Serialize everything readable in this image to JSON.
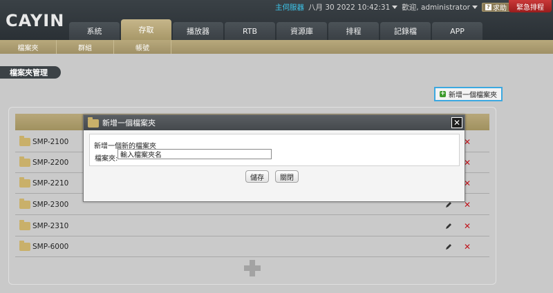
{
  "header": {
    "logo": "CAYIN",
    "server": "主伺服器",
    "datetime": "八月 30 2022 10:42:31",
    "welcome": "歡迎, administrator",
    "help": "求助",
    "emergency": "緊急排程"
  },
  "tabs": [
    "系統",
    "存取",
    "播放器",
    "RTB",
    "資源庫",
    "排程",
    "記錄檔",
    "APP"
  ],
  "active_tab": "存取",
  "subtabs": [
    "檔案夾",
    "群組",
    "帳號"
  ],
  "page_title": "檔案夾管理",
  "add_folder_button": "新增一個檔案夾",
  "folders": [
    "SMP-2100",
    "SMP-2200",
    "SMP-2210",
    "SMP-2300",
    "SMP-2310",
    "SMP-6000"
  ],
  "modal": {
    "title": "新增一個檔案夾",
    "heading": "新增一個新的檔案夾",
    "label": "檔案夾:",
    "input_value": "輸入檔案夾名",
    "save": "儲存",
    "close": "關閉"
  }
}
